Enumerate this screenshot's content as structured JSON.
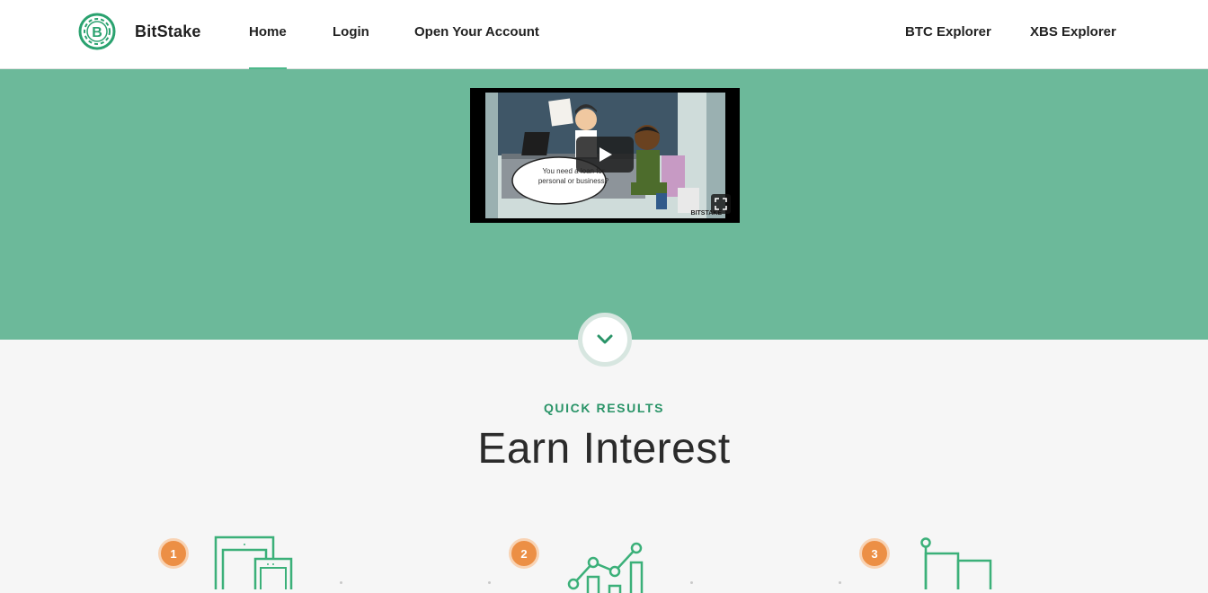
{
  "nav": {
    "brand": "BitStake",
    "links": {
      "home": "Home",
      "login": "Login",
      "open_account": "Open Your Account",
      "btc_explorer": "BTC Explorer",
      "xbs_explorer": "XBS Explorer"
    },
    "active": "Home"
  },
  "hero": {
    "video": {
      "speech_bubble": "You need a loan for personal or business?",
      "watermark": "BITSTAKE"
    }
  },
  "section": {
    "eyebrow": "QUICK RESULTS",
    "title": "Earn Interest",
    "steps": [
      {
        "number": "1",
        "icon": "devices-icon"
      },
      {
        "number": "2",
        "icon": "growth-chart-icon"
      },
      {
        "number": "3",
        "icon": "flag-icon"
      }
    ]
  },
  "colors": {
    "accent_green": "#6cb99a",
    "heading_green": "#2a9468",
    "badge_orange": "#ec8f45"
  }
}
